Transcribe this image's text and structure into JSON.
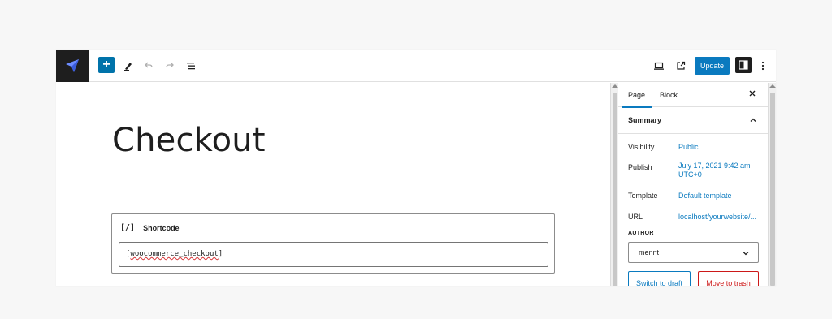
{
  "toolbar": {
    "logo_icon": "site-logo-icon",
    "update_label": "Update",
    "accent": "#0a7abf"
  },
  "editor": {
    "page_title": "Checkout",
    "shortcode_block": {
      "label": "Shortcode",
      "icon_glyph": "[/]",
      "value_prefix": "[",
      "value_main": "woocommerce_checkout",
      "value_suffix": "]"
    }
  },
  "sidebar": {
    "tabs": [
      {
        "label": "Page",
        "active": true
      },
      {
        "label": "Block",
        "active": false
      }
    ],
    "summary_title": "Summary",
    "rows": [
      {
        "label": "Visibility",
        "value": "Public"
      },
      {
        "label": "Publish",
        "value_line1": "July 17, 2021 9:42 am",
        "value_line2": "UTC+0"
      },
      {
        "label": "Template",
        "value": "Default template"
      },
      {
        "label": "URL",
        "value": "localhost/yourwebsite/..."
      }
    ],
    "author_heading": "AUTHOR",
    "author_value": "mennt",
    "switch_draft_label": "Switch to draft",
    "trash_label": "Move to trash"
  }
}
